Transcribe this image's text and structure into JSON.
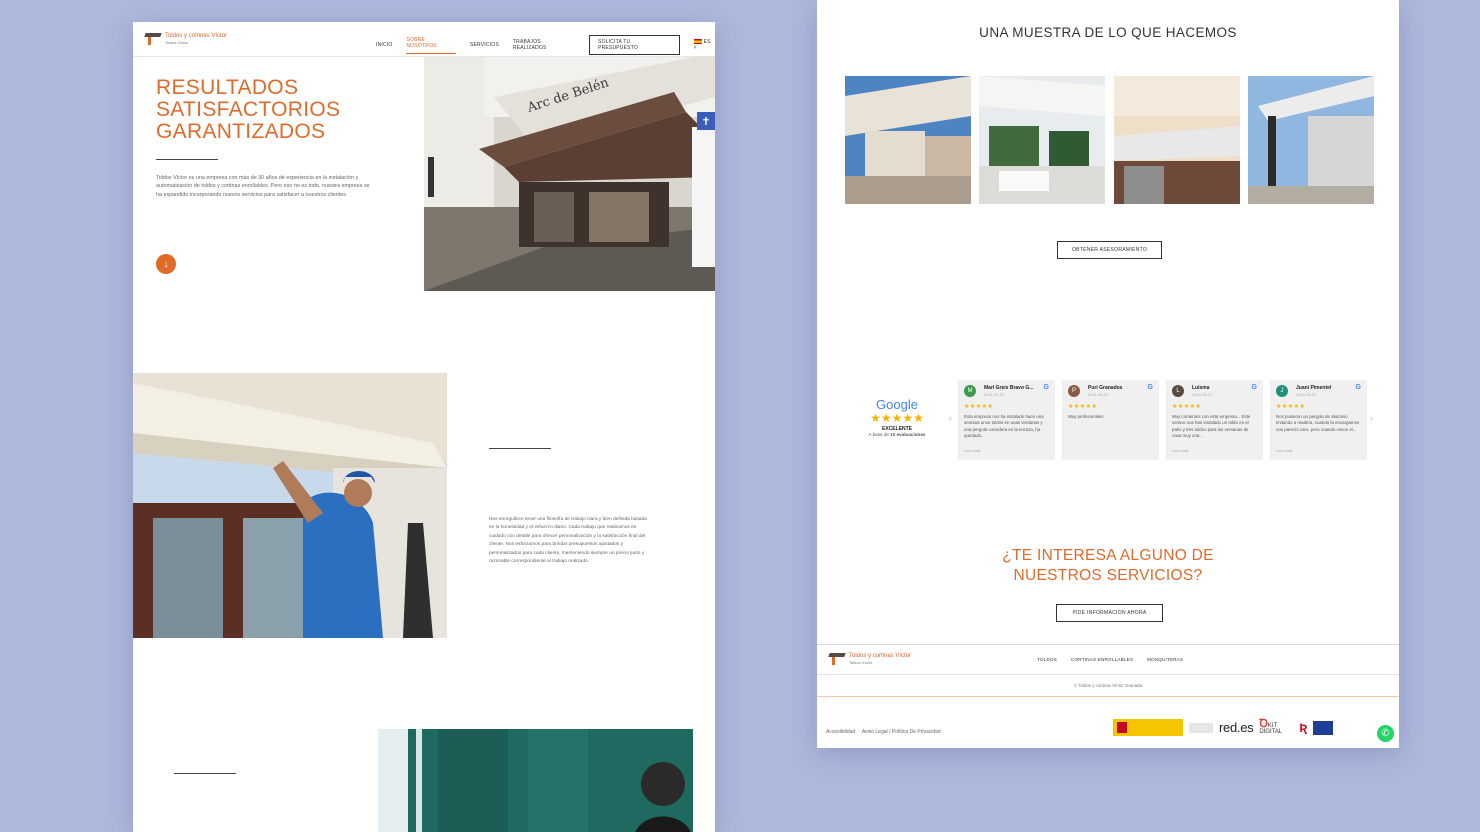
{
  "left_page": {
    "logo": {
      "name": "Toldos y cortinas Víctor",
      "sub": "Toldos Víctor"
    },
    "nav": [
      {
        "label": "INICIO"
      },
      {
        "label": "SOBRE NOSOTROS",
        "active": true
      },
      {
        "label": "SERVICIOS"
      },
      {
        "label": "TRABAJOS REALIZADOS"
      }
    ],
    "cta_label": "SOLICITA TU PRESUPUESTO",
    "lang": "ES",
    "hero_title_lines": [
      "RESULTADOS",
      "SATISFACTORIOS",
      "GARANTIZADOS"
    ],
    "hero_text": "Toldos Víctor es una empresa con más de 30 años de experiencia en la instalación y automatización de toldos y cortinas enrollables. Pero eso no es todo, nuestra empresa se ha expandido incorporando nuevos servicios para satisfacer a nuestros clientes.",
    "scroll_icon": "arrow-down-icon",
    "accessibility_icon": "accessibility-icon",
    "section2_text": "Nos enorgullece tener una filosofía de trabajo clara y bien definida basada en la honestidad y el esfuerzo diario. Cada trabajo que realizamos es cuidado con detalle para ofrecer personalización y la satisfacción final del cliente. Nos esforzamos para brindar presupuestos ajustados y personalizados para cada cliente, manteniendo siempre un precio justo y razonable correspondiente al trabajo realizado.",
    "storefront_sign": "Arc de Belén"
  },
  "right_page": {
    "gallery_title": "UNA MUESTRA DE LO QUE HACEMOS",
    "gallery_button": "OBTENER ASESORAMIENTO",
    "google": {
      "brand": "Google",
      "stars": "★★★★★",
      "rating_label": "EXCELENTE",
      "based_on": "A base de",
      "count": "10 evaluaciones"
    },
    "reviews": [
      {
        "initial": "M",
        "name": "Mari Greis Bravo G...",
        "date": "2021-07-02",
        "stars": "★★★★★",
        "text": "Esta empresa nos ha instalado hace una semana unos toldos en unas ventanas y una pergola corredera en la terraza, ha quedado...",
        "more": "Leer más",
        "color": "#3c9a4a"
      },
      {
        "initial": "P",
        "name": "Puri Granados",
        "date": "2021-05-20",
        "stars": "★★★★★",
        "text": "Muy profesionales",
        "more": "",
        "color": "#8a5a44"
      },
      {
        "initial": "L",
        "name": "Luisma",
        "date": "2020-09-17",
        "stars": "★★★★★",
        "text": "Muy contentos con esta empresa... Este verano nos han instalado un toldo en el patio y tres toldos para las ventanas de casa muy una...",
        "more": "Leer más",
        "color": "#5a4a42"
      },
      {
        "initial": "J",
        "name": "Juani Pimentel",
        "date": "2020-05-05",
        "stars": "★★★★★",
        "text": "Nos pusieron un pergola de aluminio imitando a madera, cuando la encargamos nos pareció caro, pero cuando vimos el...",
        "more": "Leer más",
        "color": "#1f8f7a"
      }
    ],
    "question_lines": [
      "¿TE INTERESA ALGUNO DE",
      "NUESTROS SERVICIOS?"
    ],
    "info_button": "PIDE INFORMACIÓN AHORA",
    "footer_logo": {
      "name": "Toldos y cortinas Víctor",
      "sub": "Toldos Víctor"
    },
    "footer_nav": [
      "TOLDOS",
      "CORTINAS ENROLLABLES",
      "MOSQUITERAS"
    ],
    "copyright": "© Toldos y cortinas Víctor Granada",
    "bottom_links": [
      "Accesibilidad",
      "Aviso Legal / Política De Privacidad"
    ],
    "funding_logos": [
      "red.es",
      "KIT DIGITAL"
    ],
    "whatsapp_icon": "whatsapp-icon"
  }
}
